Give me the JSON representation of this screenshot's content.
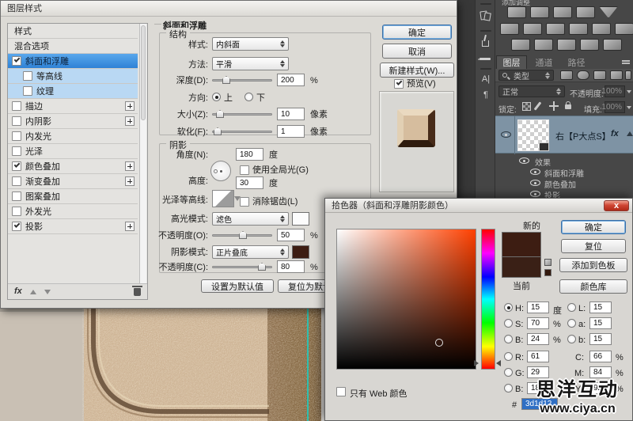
{
  "icons": {
    "close_glyph": "x",
    "fx_glyph": "fx",
    "character_glyph": "A|",
    "paragraph_glyph": "¶",
    "search_glyph": "⌕",
    "adjustment_icons": [
      "brightness-contrast",
      "levels",
      "curves",
      "exposure",
      "vibrance",
      "hue-saturation",
      "color-balance",
      "black-white",
      "photo-filter",
      "channel-mixer",
      "color-lookup",
      "invert",
      "posterize",
      "threshold",
      "gradient-map",
      "selective-color"
    ],
    "strip_panel_icons": [
      "clone-source",
      "brush-presets",
      "tool-presets",
      "character",
      "paragraph"
    ]
  },
  "layer_style": {
    "title": "图层样式",
    "list": {
      "items": [
        {
          "label": "样式"
        },
        {
          "label": "混合选项"
        },
        {
          "label": "斜面和浮雕",
          "checked": true,
          "selected": true
        },
        {
          "label": "等高线",
          "checked": false
        },
        {
          "label": "纹理",
          "checked": false
        },
        {
          "label": "描边",
          "checked": false,
          "plus": true
        },
        {
          "label": "内阴影",
          "checked": false,
          "plus": true
        },
        {
          "label": "内发光",
          "checked": false
        },
        {
          "label": "光泽",
          "checked": false
        },
        {
          "label": "颜色叠加",
          "checked": true,
          "plus": true
        },
        {
          "label": "渐变叠加",
          "checked": false,
          "plus": true
        },
        {
          "label": "图案叠加",
          "checked": false
        },
        {
          "label": "外发光",
          "checked": false
        },
        {
          "label": "投影",
          "checked": true,
          "plus": true
        }
      ]
    },
    "section_title": "斜面和浮雕",
    "structure": {
      "legend": "结构",
      "style_label": "样式:",
      "style_value": "内斜面",
      "method_label": "方法:",
      "method_value": "平滑",
      "depth_label": "深度(D):",
      "depth_value": "200",
      "depth_unit": "%",
      "direction_label": "方向:",
      "up": "上",
      "down": "下",
      "size_label": "大小(Z):",
      "size_value": "10",
      "size_unit": "像素",
      "soften_label": "软化(F):",
      "soften_value": "1",
      "soften_unit": "像素"
    },
    "shading": {
      "legend": "阴影",
      "angle_label": "角度(N):",
      "angle_value": "180",
      "angle_unit": "度",
      "use_global": "使用全局光(G)",
      "altitude_label": "高度:",
      "altitude_value": "30",
      "altitude_unit": "度",
      "gloss_label": "光泽等高线:",
      "anti_alias": "消除锯齿(L)",
      "highlight_label": "高光模式:",
      "highlight_mode": "滤色",
      "highlight_color": "#fcfcfc",
      "opacity1_label": "不透明度(O):",
      "opacity1": "50",
      "opacity1_unit": "%",
      "shadow_label": "阴影模式:",
      "shadow_mode": "正片叠底",
      "shadow_color": "#3d1d12",
      "opacity2_label": "不透明度(C):",
      "opacity2": "80",
      "opacity2_unit": "%",
      "set_default": "设置为默认值",
      "reset_default": "复位为默认值"
    },
    "ok": "确定",
    "cancel": "取消",
    "new_style": "新建样式(W)...",
    "preview": "预览(V)"
  },
  "color_picker": {
    "title": "拾色器（斜面和浮雕阴影颜色）",
    "new_label": "新的",
    "current_label": "当前",
    "ok": "确定",
    "reset": "复位",
    "add_to_swatches": "添加到色板",
    "color_libraries": "颜色库",
    "new_color": "#3d1d12",
    "current_color": "#3a2016",
    "websafe_color": "#331a0e",
    "rows": {
      "h_label": "H:",
      "h": "15",
      "h_unit": "度",
      "s_label": "S:",
      "s": "70",
      "s_unit": "%",
      "b_label": "B:",
      "b": "24",
      "b_unit": "%",
      "r_label": "R:",
      "r": "61",
      "g_label": "G:",
      "g": "29",
      "b2_label": "B:",
      "b2": "18",
      "l_label": "L:",
      "l": "15",
      "a_label": "a:",
      "a": "15",
      "bb_label": "b:",
      "bb": "15",
      "c_label": "C:",
      "c": "66",
      "c_unit": "%",
      "m_label": "M:",
      "m": "84",
      "m_unit": "%",
      "y_label": "Y:",
      "y": "92",
      "y_unit": "%"
    },
    "hex_label": "#",
    "hex": "3d1d12",
    "web_only": "只有 Web 颜色"
  },
  "panels": {
    "adjustments_title": "添加调整",
    "layers": {
      "tabs": [
        {
          "label": "图层"
        },
        {
          "label": "通道"
        },
        {
          "label": "路径"
        }
      ],
      "filter_type": "类型",
      "blend_mode": "正常",
      "opacity_label": "不透明度:",
      "opacity": "100%",
      "lock_label": "锁定:",
      "fill_label": "填充:",
      "fill": "100%",
      "layer_name": "右【P大点S】",
      "effects_label": "效果",
      "effects": [
        {
          "label": "斜面和浮雕"
        },
        {
          "label": "颜色叠加"
        },
        {
          "label": "投影"
        }
      ]
    }
  },
  "watermark": {
    "line1": "思洋互动",
    "line2": "www.ciya.cn"
  }
}
